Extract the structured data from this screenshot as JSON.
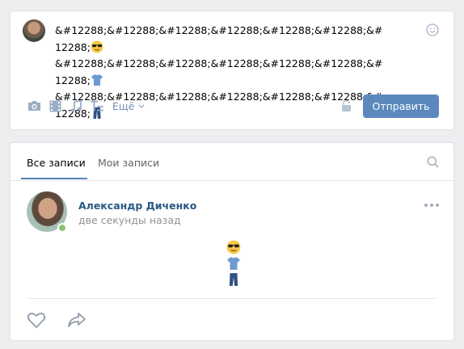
{
  "composer": {
    "text_line1": "&#12288;&#12288;&#12288;&#12288;&#12288;&#12288;&#12288;",
    "text_line2": "&#12288;&#12288;&#12288;&#12288;&#12288;&#12288;&#12288;",
    "text_line3": "&#12288;&#12288;&#12288;&#12288;&#12288;&#12288;&#12288;",
    "more_label": "Ещё",
    "submit_label": "Отправить",
    "icons": [
      "photo-icon",
      "video-icon",
      "music-icon",
      "text-format-icon",
      "lock-icon",
      "smiley-icon"
    ]
  },
  "feed": {
    "tabs": [
      {
        "label": "Все записи",
        "active": true
      },
      {
        "label": "Мои записи",
        "active": false
      }
    ],
    "post": {
      "author": "Александр Диченко",
      "time": "две секунды назад",
      "emojis": [
        "sunglasses-face",
        "t-shirt",
        "jeans"
      ]
    }
  },
  "colors": {
    "accent": "#5181b8",
    "button": "#5b88bd",
    "author": "#2a5885",
    "background": "#edeef0",
    "online": "#8ac176"
  }
}
